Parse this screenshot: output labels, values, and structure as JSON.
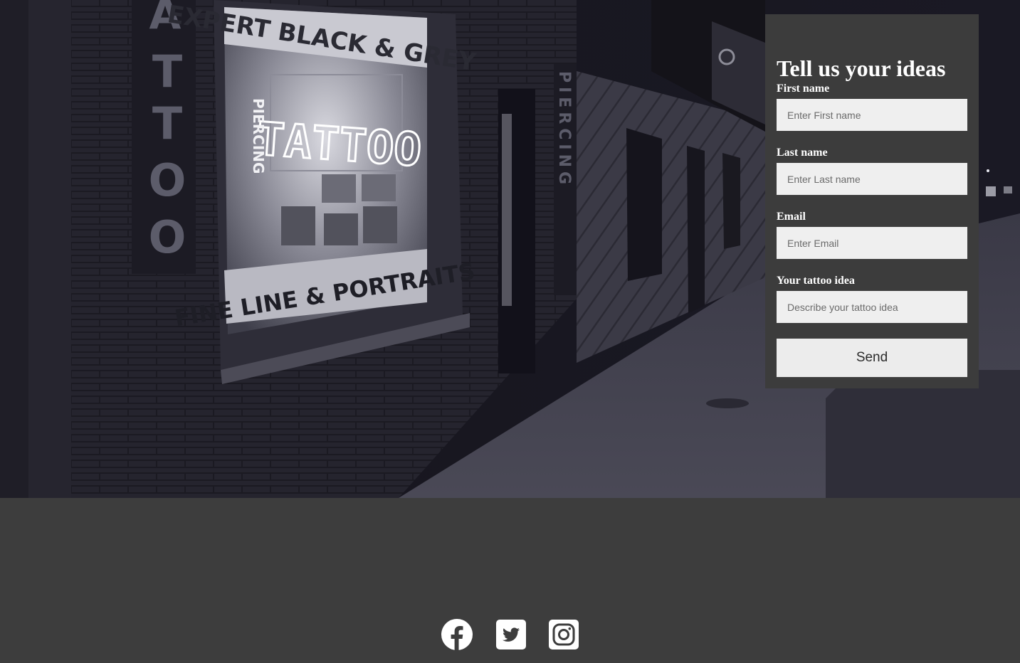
{
  "hero": {
    "window_sign_top": "EXPERT BLACK & GREY",
    "neon_sign": "TATTOO",
    "neon_vertical": "PIERCING",
    "window_sign_bottom": "FINE LINE & PORTRAITS",
    "wall_vertical_sign": "TATTOO",
    "door_vertical_sign": "PIERCING"
  },
  "form": {
    "title": "Tell us your ideas",
    "fields": [
      {
        "label": "First name",
        "placeholder": "Enter First name"
      },
      {
        "label": "Last name",
        "placeholder": "Enter Last name"
      },
      {
        "label": "Email",
        "placeholder": "Enter Email"
      },
      {
        "label": "Your tattoo idea",
        "placeholder": "Describe your tattoo idea"
      }
    ],
    "send_label": "Send"
  },
  "footer": {
    "social_icons": [
      "facebook-icon",
      "twitter-icon",
      "instagram-icon"
    ]
  },
  "colors": {
    "panel": "#3c3c3c",
    "input": "#efefef",
    "footer": "#3d3d3d",
    "text": "#ffffff"
  }
}
